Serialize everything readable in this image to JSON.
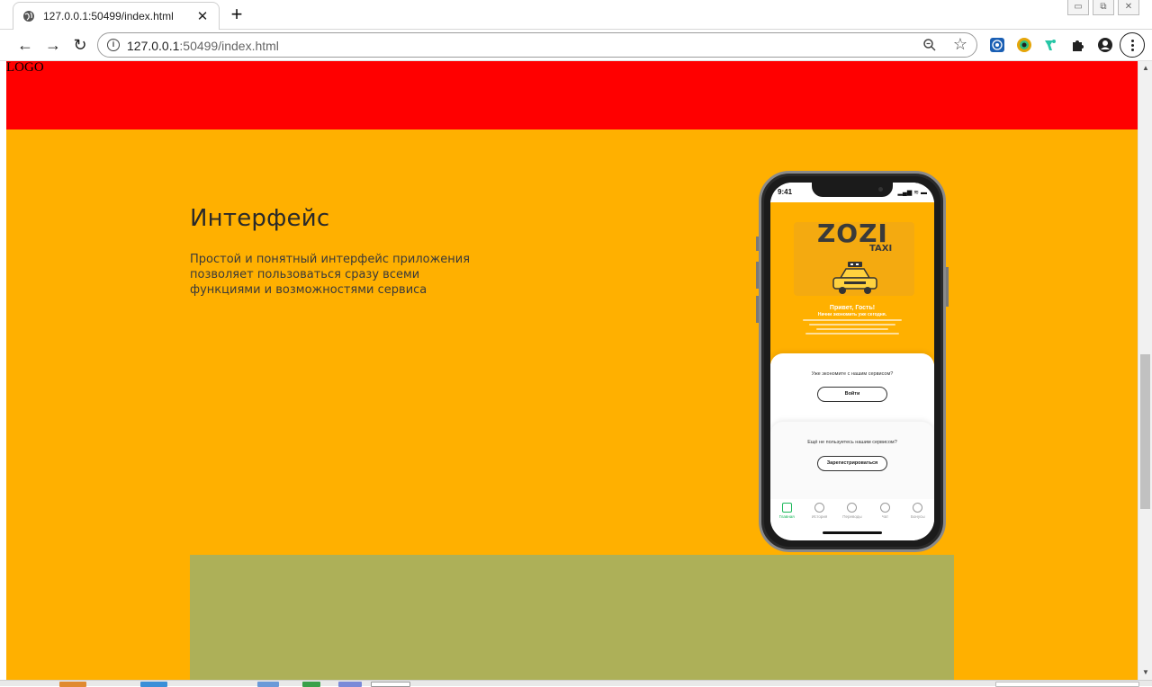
{
  "browser": {
    "tab_title": "127.0.0.1:50499/index.html",
    "tab_close": "✕",
    "new_tab": "+",
    "url_host": "127.0.0.1",
    "url_rest": ":50499/index.html",
    "info_glyph": "i",
    "star_glyph": "☆",
    "back_glyph": "←",
    "forward_glyph": "→",
    "reload_glyph": "↻",
    "extensions": [
      "target-extension-icon",
      "color-picker-extension-icon",
      "bird-extension-icon",
      "puzzle-extension-icon",
      "profile-icon"
    ]
  },
  "window_controls": {
    "minimize": "▭",
    "restore": "⧉",
    "close": "✕"
  },
  "site": {
    "logo": "LOGO",
    "colors": {
      "header": "#ff0000",
      "hero": "#ffb000",
      "panel": "#adb058"
    },
    "hero": {
      "title": "Интерфейс",
      "description": "Простой и понятный интерфейс приложения позволяет пользоваться сразу всеми функциями и возможностями сервиса"
    }
  },
  "phone": {
    "time": "9:41",
    "signal": "▂▄▆ ≋ ▬",
    "brand": "ZOZI",
    "brand_sub": "TAXI",
    "greeting": "Привет, Гость!",
    "greeting_sub": "Начни экономить уже сегодня.",
    "login_question": "Уже экономите с нашим сервисом?",
    "login_button": "Войти",
    "register_question": "Ещё не пользуетесь нашим сервисом?",
    "register_button": "Зарегистрироваться",
    "tabs": [
      {
        "label": "Главная",
        "active": true
      },
      {
        "label": "История",
        "active": false
      },
      {
        "label": "Переводы",
        "active": false
      },
      {
        "label": "Чат",
        "active": false
      },
      {
        "label": "Бонусы",
        "active": false
      }
    ]
  },
  "scrollbar": {
    "up": "▲",
    "down": "▼",
    "thumb_position": 0.64
  }
}
